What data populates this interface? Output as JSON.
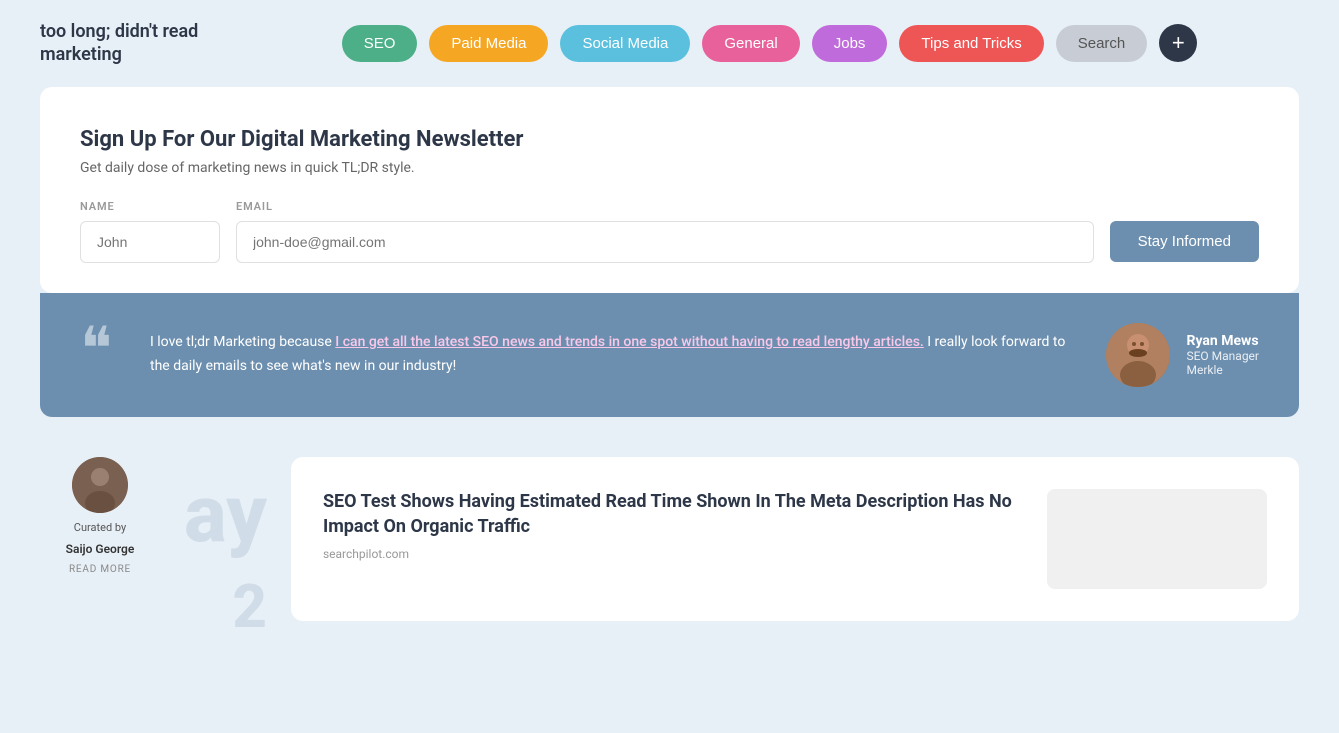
{
  "logo": {
    "line1": "too long; didn't read",
    "line2": "marketing"
  },
  "nav": {
    "items": [
      {
        "label": "SEO",
        "class": "seo"
      },
      {
        "label": "Paid Media",
        "class": "paid-media"
      },
      {
        "label": "Social Media",
        "class": "social-media"
      },
      {
        "label": "General",
        "class": "general"
      },
      {
        "label": "Jobs",
        "class": "jobs"
      },
      {
        "label": "Tips and Tricks",
        "class": "tips"
      },
      {
        "label": "Search",
        "class": "search-btn"
      }
    ],
    "plus_label": "+"
  },
  "newsletter": {
    "title": "Sign Up For Our Digital Marketing Newsletter",
    "subtitle": "Get daily dose of marketing news in quick TL;DR style.",
    "name_label": "NAME",
    "email_label": "EMAIL",
    "name_placeholder": "John",
    "email_placeholder": "john-doe@gmail.com",
    "button_label": "Stay Informed"
  },
  "testimonial": {
    "text_before": "I love tl;dr Marketing because ",
    "text_highlighted": "I can get all the latest SEO news and trends in one spot without having to read lengthy articles.",
    "text_after": " I really look forward to the daily emails to see what's new in our industry!",
    "author_name": "Ryan Mews",
    "author_title": "SEO Manager",
    "author_company": "Merkle"
  },
  "curator": {
    "label": "Curated by",
    "name": "Saijo George",
    "read_more": "READ MORE"
  },
  "decorative": {
    "text": "ay",
    "number": "2"
  },
  "article": {
    "title": "SEO Test Shows Having Estimated Read Time Shown In The Meta Description Has No Impact On Organic Traffic",
    "source": "searchpilot.com"
  }
}
